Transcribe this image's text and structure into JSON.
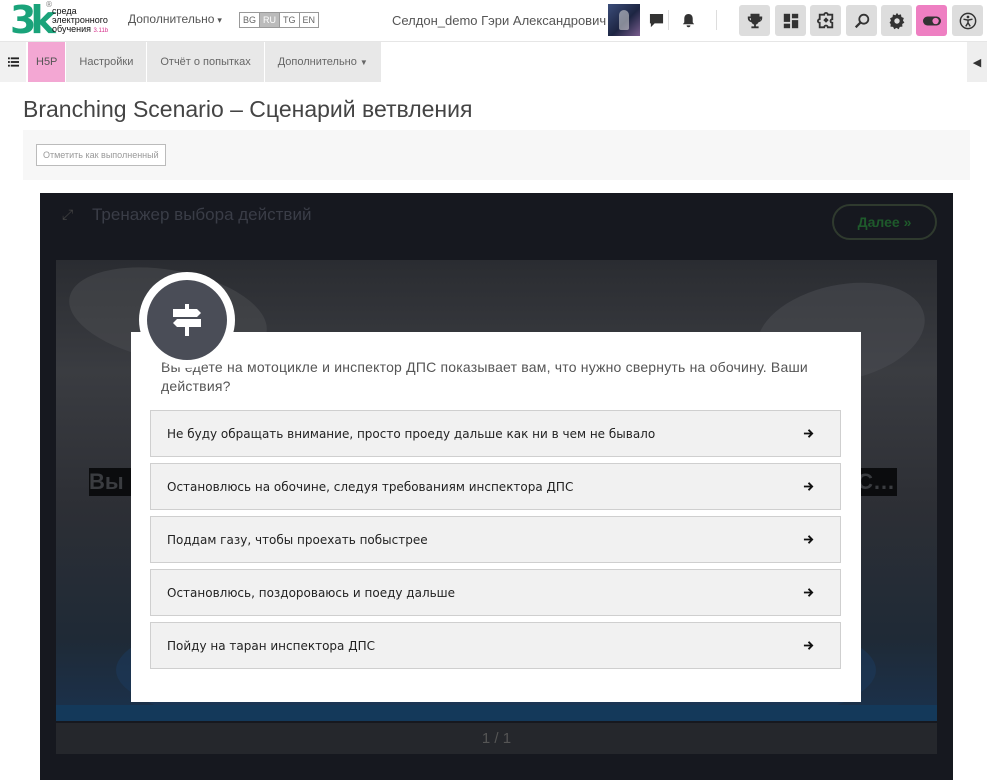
{
  "header": {
    "logo_mark": "3k",
    "logo_reg": "®",
    "logo_line1": "среда",
    "logo_line2": "электронного",
    "logo_line3": "обучения",
    "logo_sub": "3.11b",
    "more_label": "Дополнительно",
    "languages": [
      {
        "code": "BG",
        "active": false
      },
      {
        "code": "RU",
        "active": true
      },
      {
        "code": "TG",
        "active": false
      },
      {
        "code": "EN",
        "active": false
      }
    ],
    "username": "Селдон_demo Гэри Александрович",
    "icons": [
      "chat-icon",
      "bell-icon",
      "trophy-icon",
      "dashboard-grid-icon",
      "puzzle-icon",
      "search-zoom-icon",
      "gear-icon",
      "toggle-icon",
      "accessibility-icon"
    ]
  },
  "subnav": {
    "tabs": [
      {
        "label": "H5P",
        "active": true
      },
      {
        "label": "Настройки",
        "active": false
      },
      {
        "label": "Отчёт о попытках",
        "active": false
      },
      {
        "label": "Дополнительно",
        "active": false
      }
    ]
  },
  "page": {
    "title": "Branching Scenario – Сценарий ветвления",
    "mark_done": "Отметить как выполненный"
  },
  "player": {
    "title": "Тренажер выбора действий",
    "next_label": "Далее",
    "scene_text_left": "Вы",
    "scene_text_right": "С…",
    "page_indicator": "1 / 1",
    "progress": 1.0
  },
  "dialog": {
    "question": "Вы едете на мотоцикле и инспектор ДПС показывает вам, что нужно свернуть на обочину. Ваши действия?",
    "options": [
      "Не буду обращать внимание, просто проеду дальше как ни в чем не бывало",
      "Остановлюсь на обочине, следуя требованиям инспектора ДПС",
      "Поддам газу, чтобы проехать побыстрее",
      "Остановлюсь, поздороваюсь и поеду дальше",
      "Пойду на таран инспектора ДПС"
    ]
  },
  "colors": {
    "accent_pink": "#ee7fc2",
    "tab_active": "#f3a7d3",
    "logo_green": "#1aa37a",
    "player_bg": "#16181f"
  }
}
